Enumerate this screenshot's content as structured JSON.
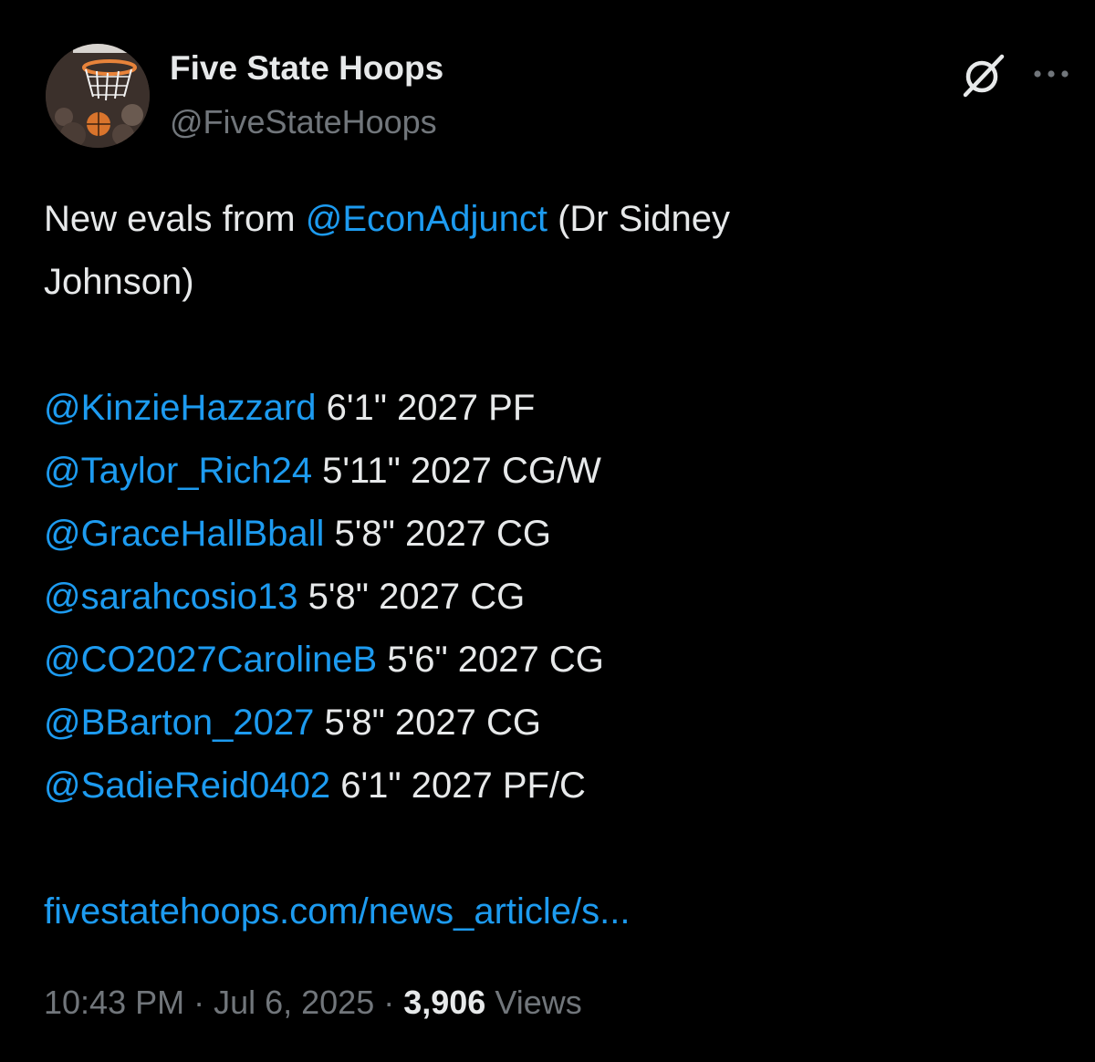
{
  "author": {
    "display_name": "Five State Hoops",
    "handle": "@FiveStateHoops",
    "avatar_icon": "basketball-hoop-avatar"
  },
  "actions": {
    "grok_icon": "grok-icon",
    "more_icon": "more-options-icon"
  },
  "body": {
    "intro_prefix": "New evals from ",
    "intro_mention": "@EconAdjunct",
    "intro_suffix": " (Dr Sidney",
    "intro_line2": "Johnson)",
    "players": [
      {
        "mention": "@KinzieHazzard",
        "details": " 6'1\" 2027 PF"
      },
      {
        "mention": "@Taylor_Rich24",
        "details": " 5'11\" 2027 CG/W"
      },
      {
        "mention": "@GraceHallBball",
        "details": " 5'8\" 2027 CG"
      },
      {
        "mention": "@sarahcosio13",
        "details": " 5'8\" 2027 CG"
      },
      {
        "mention": "@CO2027CarolineB",
        "details": " 5'6\" 2027 CG"
      },
      {
        "mention": "@BBarton_2027",
        "details": " 5'8\" 2027 CG"
      },
      {
        "mention": "@SadieReid0402",
        "details": " 6'1\" 2027 PF/C"
      }
    ],
    "link": "fivestatehoops.com/news_article/s..."
  },
  "meta": {
    "time": "10:43 PM",
    "separator": " · ",
    "date": "Jul 6, 2025",
    "views_count": "3,906",
    "views_label": " Views"
  },
  "colors": {
    "background": "#000000",
    "text": "#e7e9ea",
    "secondary": "#71767b",
    "link": "#1d9bf0"
  }
}
